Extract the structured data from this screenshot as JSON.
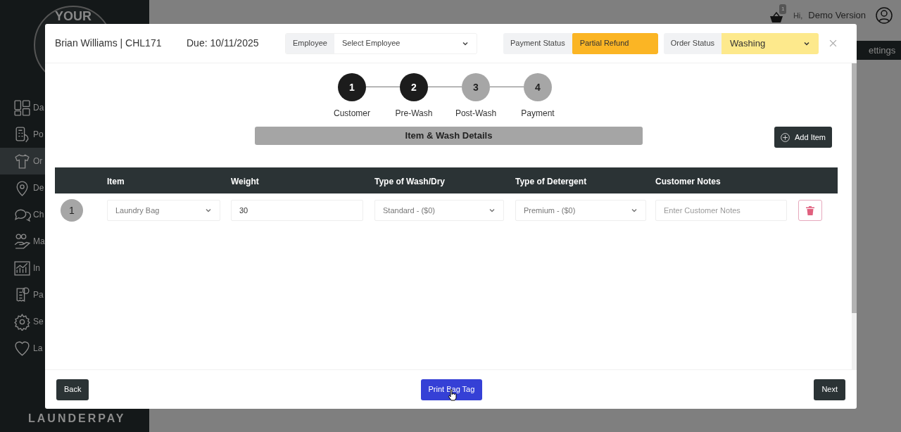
{
  "app": {
    "logo_text": "YOUR",
    "brand": "LAUNDERPAY",
    "greeting": "Hi,",
    "user": "Demo Version",
    "cart_count": "1",
    "settings_button": "ettings"
  },
  "sidebar": {
    "items": [
      {
        "label": "Da",
        "selected": false
      },
      {
        "label": "Po",
        "selected": false
      },
      {
        "label": "Or",
        "selected": true
      },
      {
        "label": "De",
        "selected": false
      },
      {
        "label": "Ch",
        "selected": false
      },
      {
        "label": "Ma",
        "selected": false
      },
      {
        "label": "In",
        "selected": false
      },
      {
        "label": "Pa",
        "selected": false
      },
      {
        "label": "Se",
        "selected": false
      },
      {
        "label": "La",
        "selected": false
      }
    ]
  },
  "modal": {
    "title": "Brian Williams | CHL171",
    "due": "Due: 10/11/2025",
    "employee": {
      "label": "Employee",
      "placeholder": "Select Employee"
    },
    "payment_status": {
      "label": "Payment Status",
      "value": "Partial Refund",
      "color": "#fbb524"
    },
    "order_status": {
      "label": "Order Status",
      "value": "Washing",
      "color": "#fde98c"
    },
    "steps": [
      {
        "number": "1",
        "label": "Customer",
        "completed": true
      },
      {
        "number": "2",
        "label": "Pre-Wash",
        "completed": true
      },
      {
        "number": "3",
        "label": "Post-Wash",
        "completed": false
      },
      {
        "number": "4",
        "label": "Payment",
        "completed": false
      }
    ],
    "section_title": "Item & Wash Details",
    "add_button": "Add Item",
    "table": {
      "columns": [
        "Item",
        "Weight",
        "Type of Wash/Dry",
        "Type of Detergent",
        "Customer Notes"
      ],
      "rows": [
        {
          "number": "1",
          "item": "Laundry Bag",
          "weight": "30",
          "wash": "Standard - ($0)",
          "detergent": "Premium - ($0)",
          "notes_placeholder": "Enter Customer Notes"
        }
      ]
    },
    "footer": {
      "back": "Back",
      "print": "Print Bag Tag",
      "next": "Next"
    }
  }
}
